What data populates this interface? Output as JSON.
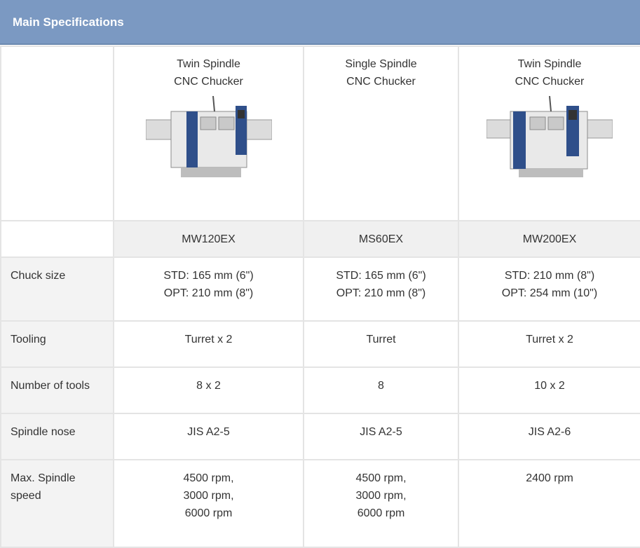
{
  "header": {
    "title": "Main Specifications"
  },
  "machines": [
    {
      "type_line1": "Twin Spindle",
      "type_line2": "CNC Chucker",
      "model": "MW120EX",
      "image": "twin-spindle-cnc-machine"
    },
    {
      "type_line1": "Single Spindle",
      "type_line2": "CNC Chucker",
      "model": "MS60EX",
      "image": ""
    },
    {
      "type_line1": "Twin Spindle",
      "type_line2": "CNC Chucker",
      "model": "MW200EX",
      "image": "twin-spindle-cnc-machine"
    }
  ],
  "rows": [
    {
      "label": "Chuck size",
      "values": [
        [
          "STD: 165 mm (6\")",
          "OPT: 210 mm (8\")"
        ],
        [
          "STD: 165 mm (6\")",
          "OPT: 210 mm (8\")"
        ],
        [
          "STD: 210 mm (8\")",
          "OPT: 254 mm (10\")"
        ]
      ]
    },
    {
      "label": "Tooling",
      "values": [
        [
          "Turret x 2"
        ],
        [
          "Turret"
        ],
        [
          "Turret x 2"
        ]
      ]
    },
    {
      "label": "Number of tools",
      "values": [
        [
          "8 x 2"
        ],
        [
          "8"
        ],
        [
          "10 x 2"
        ]
      ]
    },
    {
      "label": "Spindle nose",
      "values": [
        [
          "JIS A2-5"
        ],
        [
          "JIS A2-5"
        ],
        [
          "JIS A2-6"
        ]
      ]
    },
    {
      "label": "Max. Spindle speed",
      "label_line1": "Max. Spindle",
      "label_line2": "speed",
      "values": [
        [
          "4500 rpm,",
          "3000 rpm,",
          "6000 rpm"
        ],
        [
          "4500 rpm,",
          "3000 rpm,",
          "6000 rpm"
        ],
        [
          "2400 rpm"
        ]
      ]
    }
  ],
  "colors": {
    "title_bar": "#7b99c2",
    "machine_blue": "#2f4f8a",
    "label_bg": "#f3f3f3"
  }
}
